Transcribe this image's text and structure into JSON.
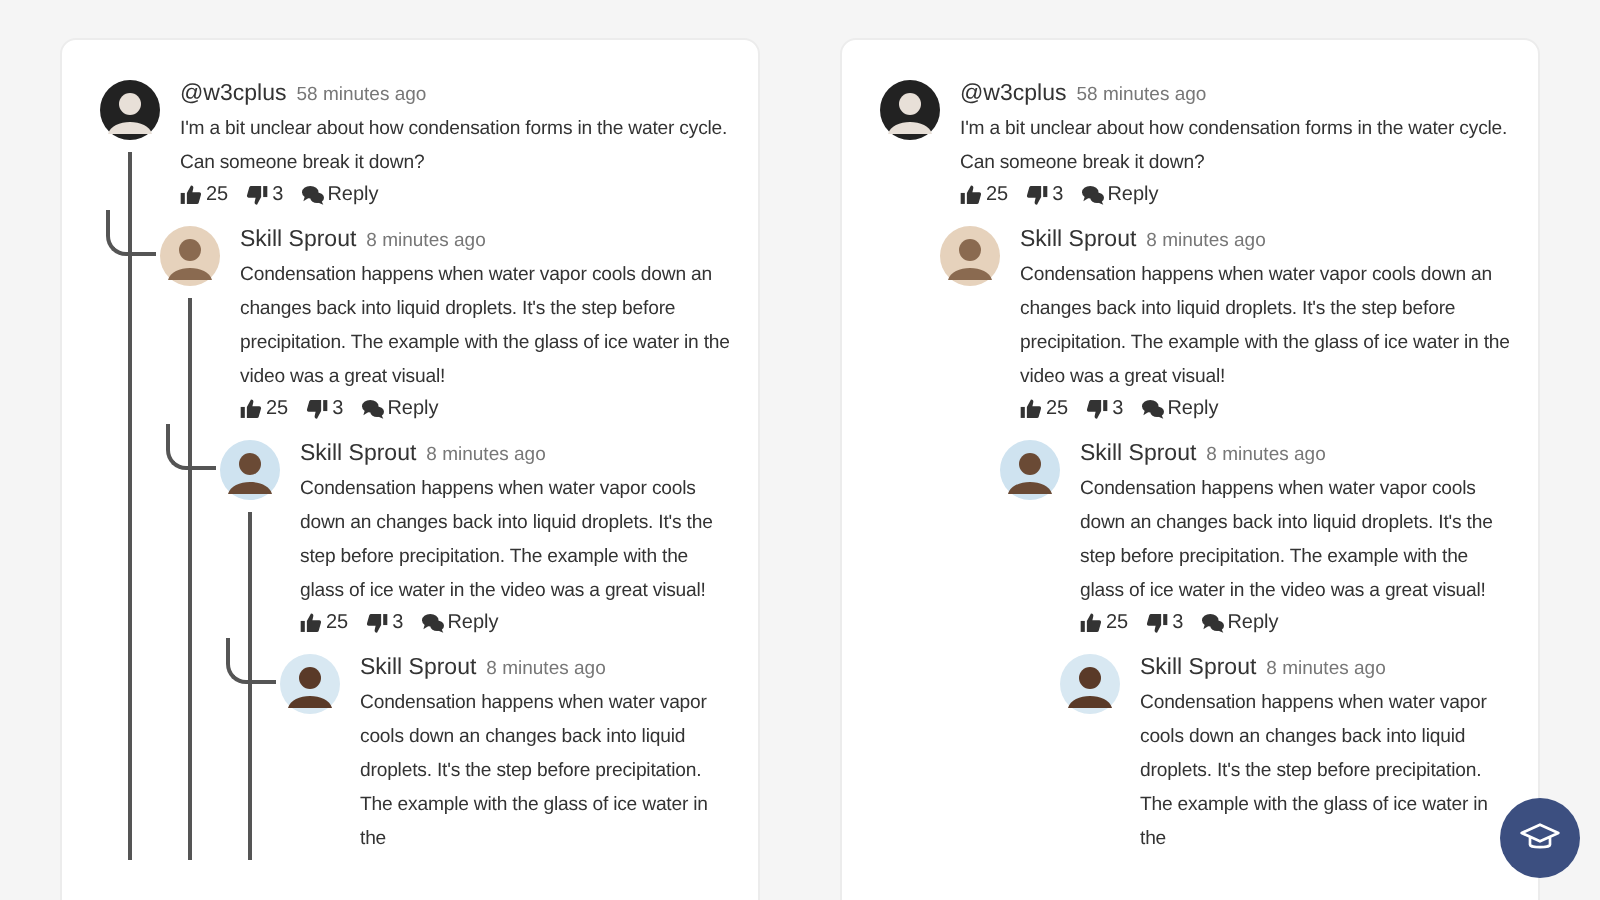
{
  "panels": [
    {
      "kind": "threaded",
      "comments": [
        {
          "author": "@w3cplus",
          "time": "58 minutes ago",
          "text": "I'm a bit unclear about how condensation forms in the water cycle. Can someone break it down?",
          "likes": "25",
          "dislikes": "3",
          "reply": "Reply",
          "children": [
            {
              "author": "Skill Sprout",
              "time": "8 minutes ago",
              "text": "Condensation happens when water vapor cools down an changes back into liquid droplets. It's the step before precipitation. The example with the glass of ice water in the video was a great visual!",
              "likes": "25",
              "dislikes": "3",
              "reply": "Reply",
              "children": [
                {
                  "author": "Skill Sprout",
                  "time": "8 minutes ago",
                  "text": "Condensation happens when water vapor cools down an changes back into liquid droplets. It's the step before precipitation. The example with the glass of ice water in the video was a great visual!",
                  "likes": "25",
                  "dislikes": "3",
                  "reply": "Reply",
                  "children": [
                    {
                      "author": "Skill Sprout",
                      "time": "8 minutes ago",
                      "text": "Condensation happens when water vapor cools down an changes back into liquid droplets. It's the step before precipitation. The example with the glass of ice water in the"
                    }
                  ]
                }
              ]
            }
          ]
        }
      ]
    },
    {
      "kind": "plain",
      "comments": [
        {
          "author": "@w3cplus",
          "time": "58 minutes ago",
          "text": "I'm a bit unclear about how condensation forms in the water cycle. Can someone break it down?",
          "likes": "25",
          "dislikes": "3",
          "reply": "Reply",
          "children": [
            {
              "author": "Skill Sprout",
              "time": "8 minutes ago",
              "text": "Condensation happens when water vapor cools down an changes back into liquid droplets. It's the step before precipitation. The example with the glass of ice water in the video was a great visual!",
              "likes": "25",
              "dislikes": "3",
              "reply": "Reply",
              "children": [
                {
                  "author": "Skill Sprout",
                  "time": "8 minutes ago",
                  "text": "Condensation happens when water vapor cools down an changes back into liquid droplets. It's the step before precipitation. The example with the glass of ice water in the video was a great visual!",
                  "likes": "25",
                  "dislikes": "3",
                  "reply": "Reply",
                  "children": [
                    {
                      "author": "Skill Sprout",
                      "time": "8 minutes ago",
                      "text": "Condensation happens when water vapor cools down an changes back into liquid droplets. It's the step before precipitation. The example with the glass of ice water in the"
                    }
                  ]
                }
              ]
            }
          ]
        }
      ]
    }
  ]
}
